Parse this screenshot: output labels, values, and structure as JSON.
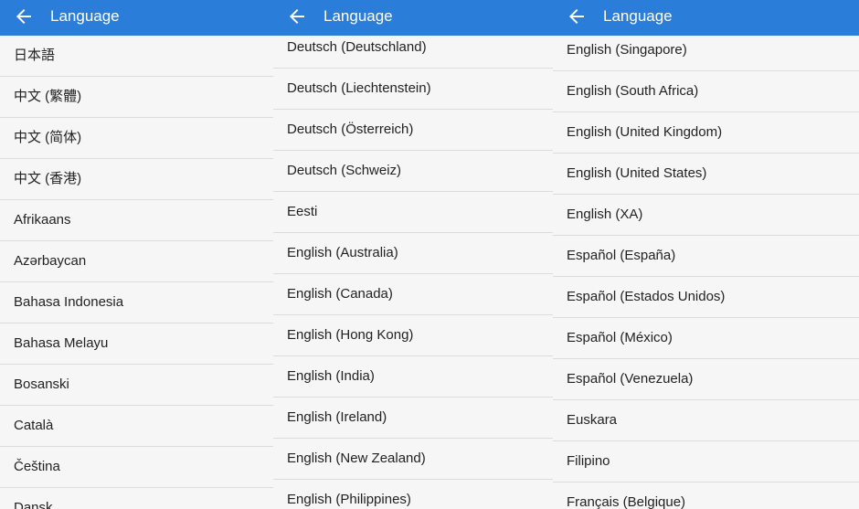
{
  "colors": {
    "appbar": "#2a7ed9",
    "list_background": "#f6f6f6",
    "divider": "#dcdcdc",
    "text": "#222222"
  },
  "panels": [
    {
      "title": "Language",
      "back_icon": "arrow-left-icon",
      "items": [
        "日本語",
        "中文 (繁體)",
        "中文 (简体)",
        "中文 (香港)",
        "Afrikaans",
        "Azərbaycan",
        "Bahasa Indonesia",
        "Bahasa Melayu",
        "Bosanski",
        "Català",
        "Čeština",
        "Dansk"
      ]
    },
    {
      "title": "Language",
      "back_icon": "arrow-left-icon",
      "items": [
        "Deutsch (Deutschland)",
        "Deutsch (Liechtenstein)",
        "Deutsch (Österreich)",
        "Deutsch (Schweiz)",
        "Eesti",
        "English (Australia)",
        "English (Canada)",
        "English (Hong Kong)",
        "English (India)",
        "English (Ireland)",
        "English (New Zealand)",
        "English (Philippines)"
      ]
    },
    {
      "title": "Language",
      "back_icon": "arrow-left-icon",
      "items": [
        "English (Singapore)",
        "English (South Africa)",
        "English (United Kingdom)",
        "English (United States)",
        "English (XA)",
        "Español (España)",
        "Español (Estados Unidos)",
        "Español (México)",
        "Español (Venezuela)",
        "Euskara",
        "Filipino",
        "Français (Belgique)"
      ]
    }
  ]
}
